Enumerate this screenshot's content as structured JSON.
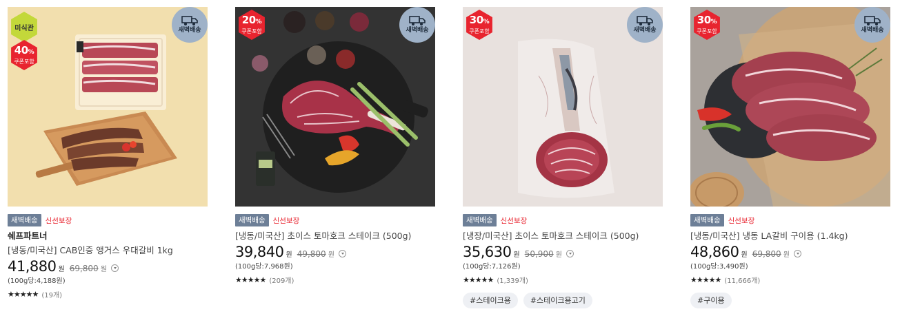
{
  "products": [
    {
      "top_badge": "미식관",
      "discount": "40",
      "discount_unit": "%",
      "discount_sub": "쿠폰포함",
      "delivery_badge": "새벽배송",
      "tag_delivery": "새벽배송",
      "tag_fresh": "신선보장",
      "brand": "쉐프파트너",
      "title": "[냉동/미국산] CAB인증 앵거스 우대갈비 1kg",
      "price": "41,880",
      "price_unit": "원",
      "original_price": "69,800",
      "original_unit": "원",
      "unit_price": "(100g당:4,188원)",
      "stars": "★★★★★",
      "review_count": "(19개)",
      "hashtags": []
    },
    {
      "discount": "20",
      "discount_unit": "%",
      "discount_sub": "쿠폰포함",
      "delivery_badge": "새벽배송",
      "tag_delivery": "새벽배송",
      "tag_fresh": "신선보장",
      "title": "[냉동/미국산] 초이스 토마호크 스테이크 (500g)",
      "price": "39,840",
      "price_unit": "원",
      "original_price": "49,800",
      "original_unit": "원",
      "unit_price": "(100g당:7,968원)",
      "stars": "★★★★★",
      "review_count": "(209개)",
      "hashtags": []
    },
    {
      "discount": "30",
      "discount_unit": "%",
      "discount_sub": "쿠폰포함",
      "delivery_badge": "새벽배송",
      "tag_delivery": "새벽배송",
      "tag_fresh": "신선보장",
      "title": "[냉장/미국산] 초이스 토마호크 스테이크 (500g)",
      "price": "35,630",
      "price_unit": "원",
      "original_price": "50,900",
      "original_unit": "원",
      "unit_price": "(100g당:7,126원)",
      "stars": "★★★★★",
      "review_count": "(1,339개)",
      "hashtags": [
        "#스테이크용",
        "#스테이크용고기"
      ]
    },
    {
      "discount": "30",
      "discount_unit": "%",
      "discount_sub": "쿠폰포함",
      "delivery_badge": "새벽배송",
      "tag_delivery": "새벽배송",
      "tag_fresh": "신선보장",
      "title": "[냉동/미국산] 냉동 LA갈비 구이용 (1.4kg)",
      "price": "48,860",
      "price_unit": "원",
      "original_price": "69,800",
      "original_unit": "원",
      "unit_price": "(100g당:3,490원)",
      "stars": "★★★★★",
      "review_count": "(11,666개)",
      "hashtags": [
        "#구이용"
      ]
    }
  ],
  "colors": {
    "discount_badge": "#e8242f",
    "delivery_badge": "#9fb2c8",
    "dawn_tag": "#6d7f97",
    "fresh_text": "#e8242f",
    "gourmet_badge": "#c3d83a",
    "hashtag_bg": "#eef0f4"
  },
  "icons": [
    "truck-icon",
    "info-circle-icon",
    "star-icon"
  ]
}
